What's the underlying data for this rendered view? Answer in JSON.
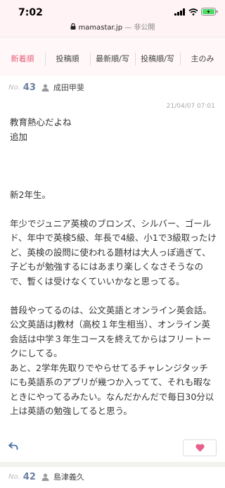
{
  "status": {
    "time": "7:02"
  },
  "urlbar": {
    "domain": "mamastar.jp",
    "suffix": "— 非公開"
  },
  "tabs": [
    {
      "label": "新着順"
    },
    {
      "label": "投稿順"
    },
    {
      "label": "最新順/写"
    },
    {
      "label": "投稿順/写"
    },
    {
      "label": "主のみ"
    }
  ],
  "post": {
    "no_label": "No.",
    "number": "43",
    "user": "成田甲斐",
    "date": "21/04/07 07:01",
    "body": "教育熱心だよね\n追加\n\n\n\n新2年生。\n\n年少でジュニア英検のブロンズ、シルバー、ゴールド、年中で英検5級、年長で4級、小1で3級取ったけど、英検の設問に使われる題材は大人っぽ過ぎて、子どもが勉強するにはあまり楽しくなさそうなので、暫くは受けなくていいかなと思ってる。\n\n普段やってるのは、公文英語とオンライン英会話。公文英語はJ教材（高校１年生相当）、オンライン英会話は中学３年生コースを終えてからはフリートークにしてる。\nあと、2学年先取りでやらせてるチャレンジタッチにも英語系のアプリが幾つか入ってて、それも暇なときにやってるみたい。なんだかんだで毎日30分以上は英語の勉強してると思う。"
  },
  "post2": {
    "no_label": "No.",
    "number": "42",
    "user": "島津義久"
  },
  "colors": {
    "accent": "#e8607a",
    "number": "#6a7fa0",
    "heart": "#e8608a"
  }
}
